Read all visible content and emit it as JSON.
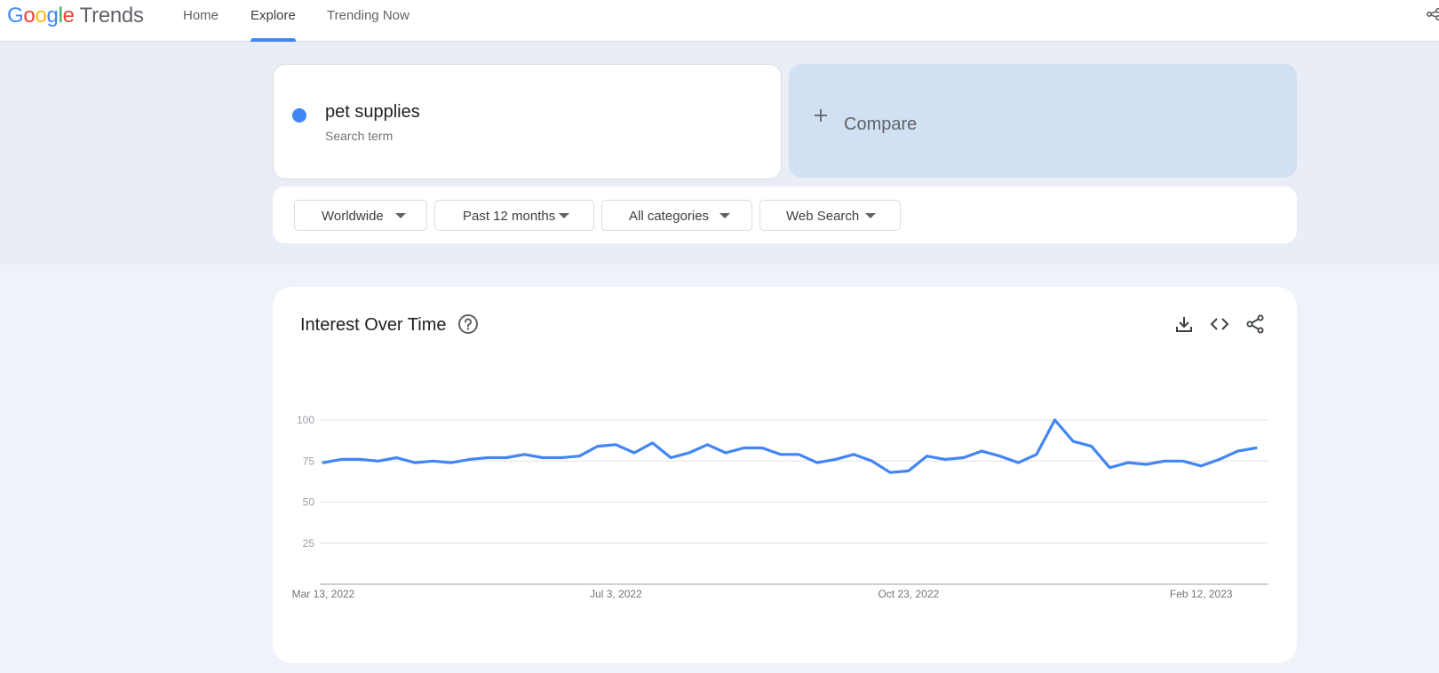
{
  "app": {
    "logo_word": "Google",
    "logo_product": "Trends"
  },
  "nav": {
    "home": "Home",
    "explore": "Explore",
    "trending": "Trending Now"
  },
  "search": {
    "term": "pet supplies",
    "term_type": "Search term",
    "term_color": "#4285f4",
    "compare_label": "Compare"
  },
  "filters": {
    "region": "Worldwide",
    "time": "Past 12 months",
    "category": "All categories",
    "property": "Web Search"
  },
  "panel": {
    "title": "Interest Over Time",
    "icons": [
      "help-icon",
      "download-icon",
      "embed-icon",
      "share-icon"
    ]
  },
  "chart_data": {
    "type": "line",
    "title": "Interest Over Time",
    "ylim": [
      0,
      100
    ],
    "y_ticks": [
      100,
      75,
      50,
      25
    ],
    "x_tick_labels": [
      "Mar 13, 2022",
      "Jul 3, 2022",
      "Oct 23, 2022",
      "Feb 12, 2023"
    ],
    "grid": true,
    "series": [
      {
        "color": "#4285f4",
        "x": [
          "2022-03-13",
          "2022-03-20",
          "2022-03-27",
          "2022-04-03",
          "2022-04-10",
          "2022-04-17",
          "2022-04-24",
          "2022-05-01",
          "2022-05-08",
          "2022-05-15",
          "2022-05-22",
          "2022-05-29",
          "2022-06-05",
          "2022-06-12",
          "2022-06-19",
          "2022-06-26",
          "2022-07-03",
          "2022-07-10",
          "2022-07-17",
          "2022-07-24",
          "2022-07-31",
          "2022-08-07",
          "2022-08-14",
          "2022-08-21",
          "2022-08-28",
          "2022-09-04",
          "2022-09-11",
          "2022-09-18",
          "2022-09-25",
          "2022-10-02",
          "2022-10-09",
          "2022-10-16",
          "2022-10-23",
          "2022-10-30",
          "2022-11-06",
          "2022-11-13",
          "2022-11-20",
          "2022-11-27",
          "2022-12-04",
          "2022-12-11",
          "2022-12-18",
          "2022-12-25",
          "2023-01-01",
          "2023-01-08",
          "2023-01-15",
          "2023-01-22",
          "2023-01-29",
          "2023-02-05",
          "2023-02-12",
          "2023-02-19",
          "2023-02-26",
          "2023-03-05"
        ],
        "values": [
          74,
          76,
          76,
          75,
          77,
          74,
          75,
          74,
          76,
          77,
          77,
          79,
          77,
          77,
          78,
          84,
          85,
          80,
          86,
          77,
          80,
          85,
          80,
          83,
          83,
          79,
          79,
          74,
          76,
          79,
          75,
          68,
          69,
          78,
          76,
          77,
          81,
          78,
          74,
          79,
          100,
          87,
          84,
          71,
          74,
          73,
          75,
          75,
          72,
          76,
          81,
          83
        ]
      }
    ]
  }
}
